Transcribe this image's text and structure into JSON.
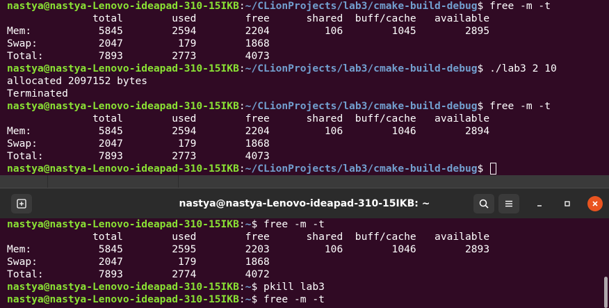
{
  "colors": {
    "terminal_bg": "#300a24",
    "prompt_user": "#8ae234",
    "prompt_path": "#729fcf",
    "headerbar_bg": "#2b2b2b",
    "close_button": "#e95420"
  },
  "top_terminal": {
    "lines": [
      {
        "user": "nastya@nastya-Lenovo-ideapad-310-15IKB",
        "path": "~/CLionProjects/lab3/cmake-build-debug",
        "cmd": "$ free -m -t"
      },
      {
        "text": "              total        used        free      shared  buff/cache   available"
      },
      {
        "text": "Mem:           5845        2594        2204         106        1045        2895"
      },
      {
        "text": "Swap:          2047         179        1868"
      },
      {
        "text": "Total:         7893        2773        4073"
      },
      {
        "user": "nastya@nastya-Lenovo-ideapad-310-15IKB",
        "path": "~/CLionProjects/lab3/cmake-build-debug",
        "cmd": "$ ./lab3 2 10"
      },
      {
        "text": "allocated 2097152 bytes"
      },
      {
        "text": "Terminated"
      },
      {
        "user": "nastya@nastya-Lenovo-ideapad-310-15IKB",
        "path": "~/CLionProjects/lab3/cmake-build-debug",
        "cmd": "$ free -m -t"
      },
      {
        "text": "              total        used        free      shared  buff/cache   available"
      },
      {
        "text": "Mem:           5845        2594        2204         106        1046        2894"
      },
      {
        "text": "Swap:          2047         179        1868"
      },
      {
        "text": "Total:         7893        2773        4073"
      },
      {
        "user": "nastya@nastya-Lenovo-ideapad-310-15IKB",
        "path": "~/CLionProjects/lab3/cmake-build-debug",
        "cmd": "$ ",
        "cursor": true
      }
    ]
  },
  "bottom_window": {
    "title": "nastya@nastya-Lenovo-ideapad-310-15IKB: ~",
    "icons": {
      "new_tab": "new-tab-icon",
      "search": "search-icon",
      "menu": "hamburger-menu-icon",
      "minimize": "minimize-icon",
      "maximize": "maximize-icon",
      "close": "close-icon"
    }
  },
  "bottom_terminal": {
    "lines": [
      {
        "user": "nastya@nastya-Lenovo-ideapad-310-15IKB",
        "path": "~",
        "cmd": "$ free -m -t"
      },
      {
        "text": "              total        used        free      shared  buff/cache   available"
      },
      {
        "text": "Mem:           5845        2595        2203         106        1046        2893"
      },
      {
        "text": "Swap:          2047         179        1868"
      },
      {
        "text": "Total:         7893        2774        4072"
      },
      {
        "user": "nastya@nastya-Lenovo-ideapad-310-15IKB",
        "path": "~",
        "cmd": "$ pkill lab3"
      },
      {
        "user": "nastya@nastya-Lenovo-ideapad-310-15IKB",
        "path": "~",
        "cmd": "$ free -m -t"
      }
    ]
  }
}
